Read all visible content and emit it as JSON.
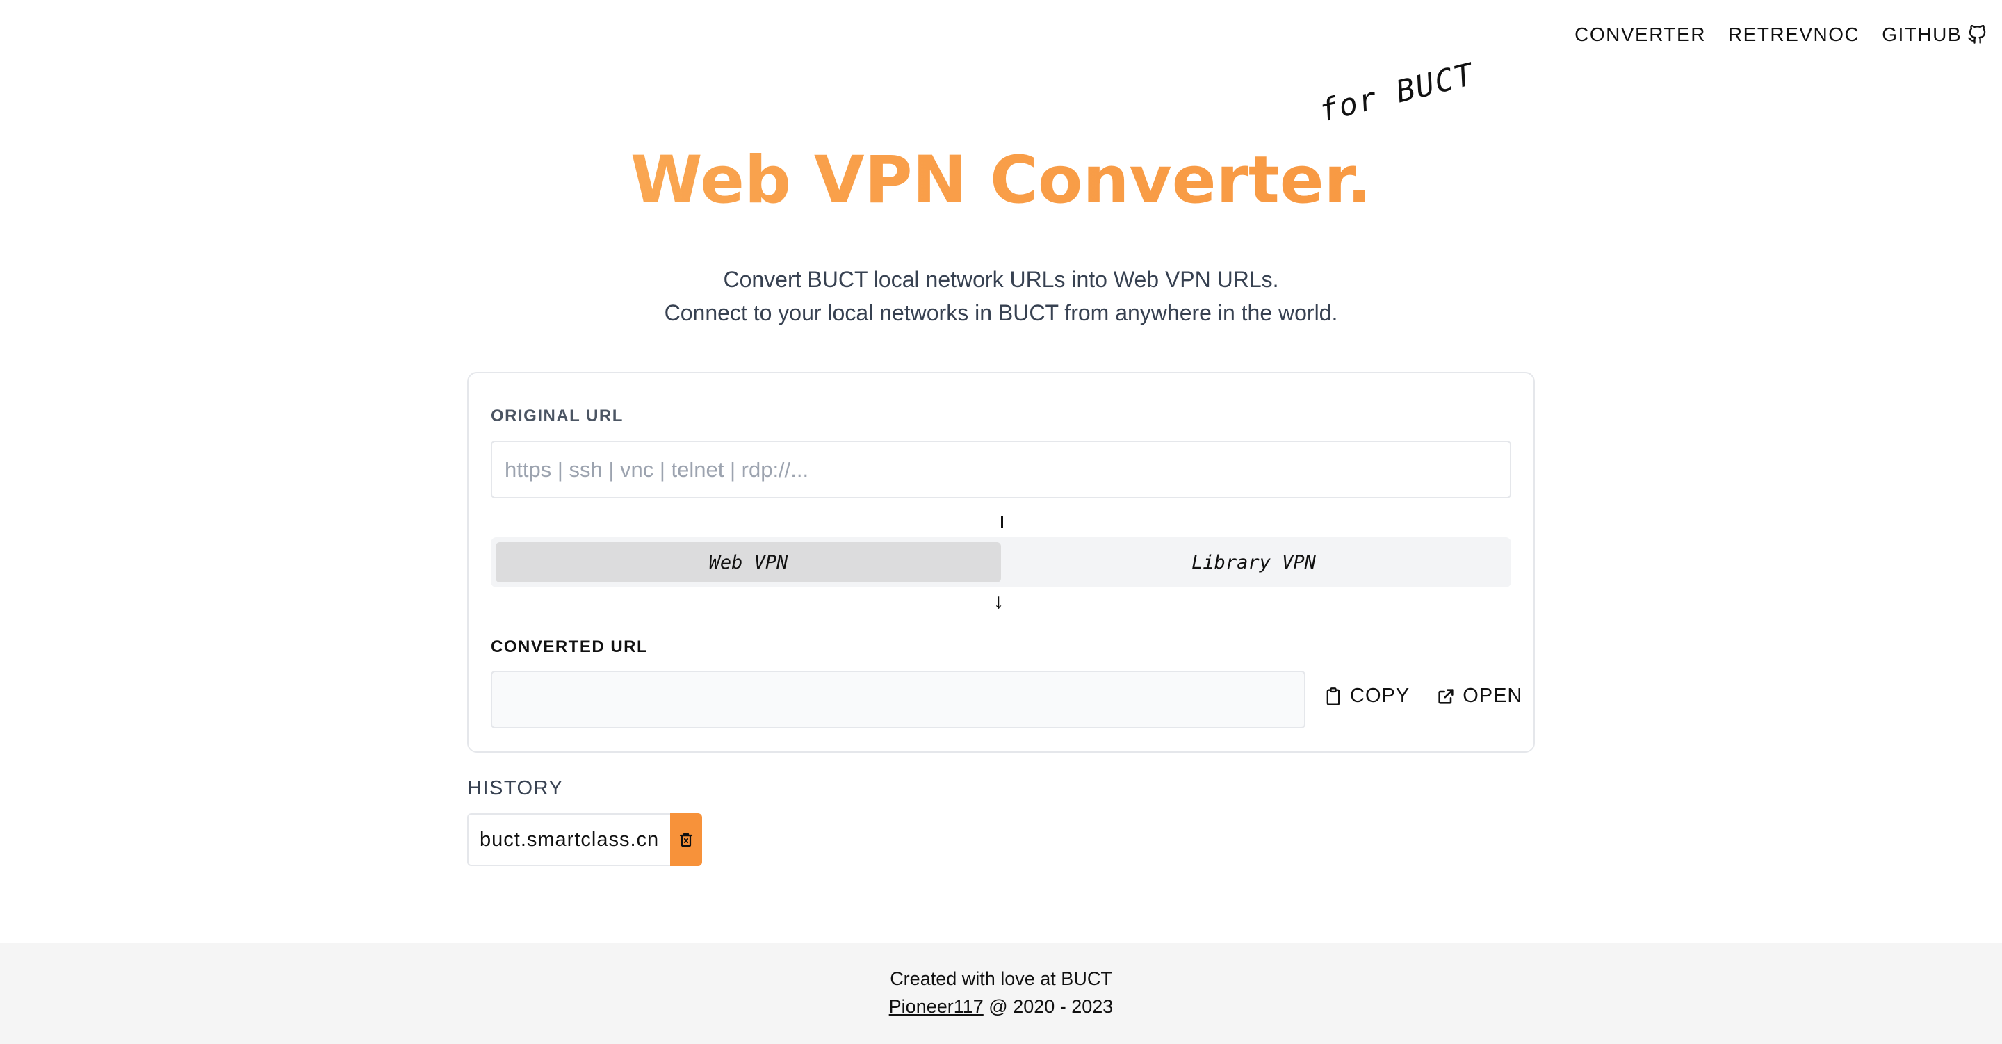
{
  "nav": {
    "converter": "CONVERTER",
    "retrevnoc": "RETREVNOC",
    "github": "GITHUB"
  },
  "hero": {
    "title": "Web VPN Converter.",
    "tag": "for BUCT",
    "subtitle_line1": "Convert BUCT local network URLs into Web VPN URLs.",
    "subtitle_line2": "Connect to your local networks in BUCT from anywhere in the world."
  },
  "card": {
    "original_label": "ORIGINAL URL",
    "original_placeholder": "https | ssh | vnc | telnet | rdp://...",
    "original_value": "",
    "modes": [
      "Web VPN",
      "Library VPN"
    ],
    "active_mode": "Web VPN",
    "converted_label": "CONVERTED URL",
    "converted_value": "",
    "copy_label": "COPY",
    "open_label": "OPEN"
  },
  "history": {
    "label": "HISTORY",
    "items": [
      "buct.smartclass.cn"
    ]
  },
  "footer": {
    "line1": "Created with love at BUCT",
    "author": "Pioneer117",
    "years": " @ 2020 - 2023"
  },
  "colors": {
    "accent": "#f7923a",
    "gradient_start": "#fbbf6c"
  }
}
